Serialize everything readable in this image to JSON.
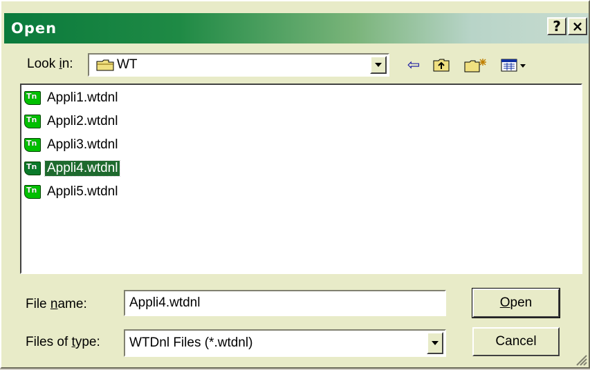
{
  "window": {
    "title": "Open"
  },
  "titlebar": {
    "help_label": "?",
    "close_label": "×"
  },
  "look_in": {
    "label_pre": "Look ",
    "label_u": "i",
    "label_post": "n:",
    "value": "WT",
    "icon": "folder-icon"
  },
  "toolbar": {
    "back_icon": "⇦",
    "up_icon": "⮤",
    "new_folder_icon": "✱",
    "view_icon": "▦▾"
  },
  "files": [
    {
      "name": "Appli1.wtdnl",
      "selected": false
    },
    {
      "name": "Appli2.wtdnl",
      "selected": false
    },
    {
      "name": "Appli3.wtdnl",
      "selected": false
    },
    {
      "name": "Appli4.wtdnl",
      "selected": true
    },
    {
      "name": "Appli5.wtdnl",
      "selected": false
    }
  ],
  "file_icon_text": "Tn",
  "file_name": {
    "label_pre": "File ",
    "label_u": "n",
    "label_post": "ame:",
    "value": "Appli4.wtdnl"
  },
  "file_type": {
    "label_pre": "Files of ",
    "label_u": "t",
    "label_post": "ype:",
    "value": "WTDnl Files (*.wtdnl)"
  },
  "buttons": {
    "open_u": "O",
    "open_rest": "pen",
    "cancel": "Cancel"
  }
}
